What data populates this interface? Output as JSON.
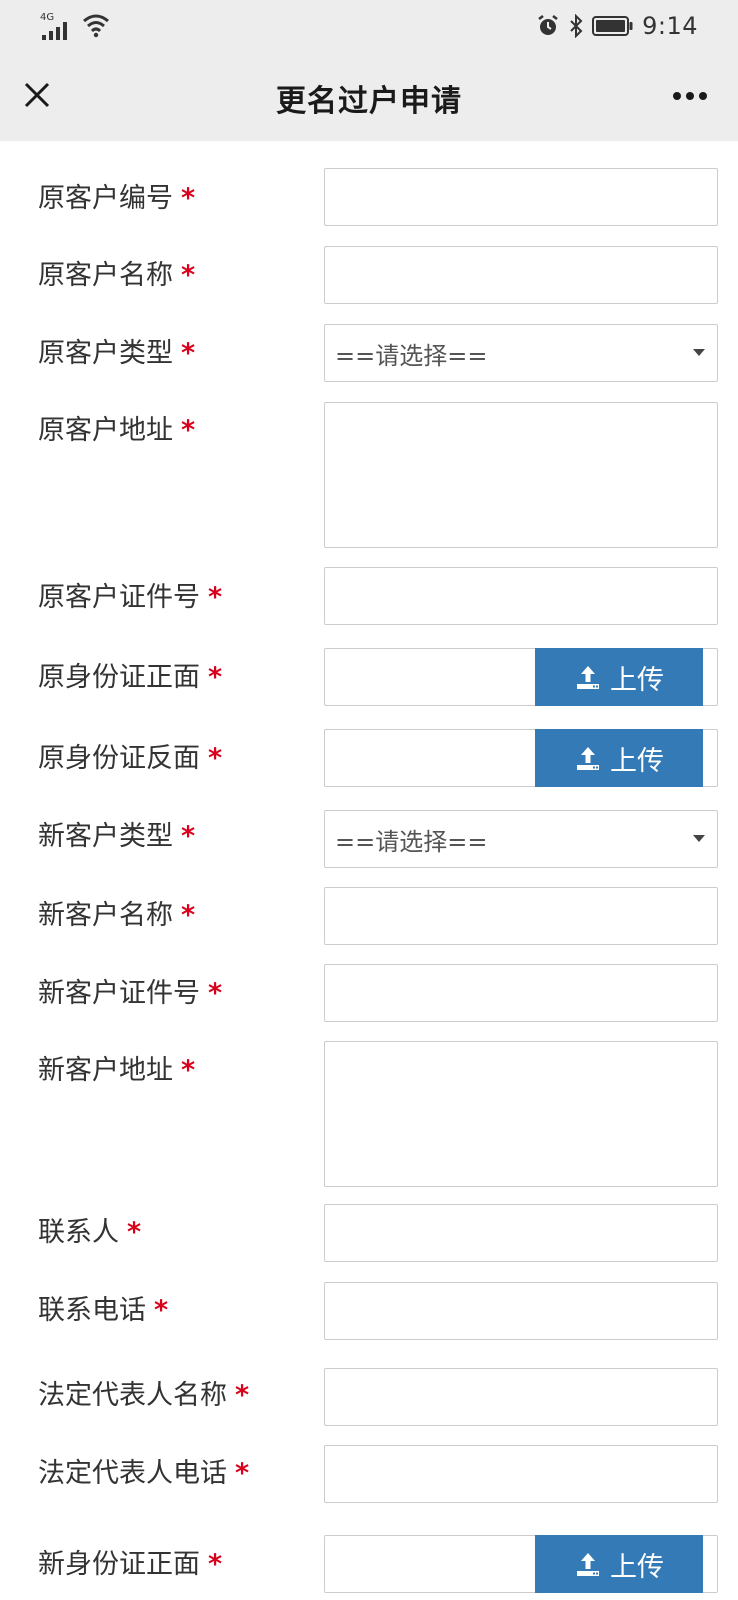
{
  "status_bar": {
    "network": "4G",
    "time": "9:14"
  },
  "nav": {
    "title": "更名过户申请"
  },
  "form": {
    "required_mark": "*",
    "select_placeholder": "==请选择==",
    "upload_label": "上传",
    "fields": [
      {
        "label": "原客户编号",
        "type": "text"
      },
      {
        "label": "原客户名称",
        "type": "text"
      },
      {
        "label": "原客户类型",
        "type": "select"
      },
      {
        "label": "原客户地址",
        "type": "textarea"
      },
      {
        "label": "原客户证件号",
        "type": "text"
      },
      {
        "label": "原身份证正面",
        "type": "upload"
      },
      {
        "label": "原身份证反面",
        "type": "upload"
      },
      {
        "label": "新客户类型",
        "type": "select"
      },
      {
        "label": "新客户名称",
        "type": "text"
      },
      {
        "label": "新客户证件号",
        "type": "text"
      },
      {
        "label": "新客户地址",
        "type": "textarea"
      },
      {
        "label": "联系人",
        "type": "text"
      },
      {
        "label": "联系电话",
        "type": "text"
      },
      {
        "label": "法定代表人名称",
        "type": "text"
      },
      {
        "label": "法定代表人电话",
        "type": "text"
      },
      {
        "label": "新身份证正面",
        "type": "upload"
      }
    ]
  },
  "colors": {
    "required": "#d9001b",
    "upload_button": "#337ab7",
    "bar_background": "#ededed"
  }
}
